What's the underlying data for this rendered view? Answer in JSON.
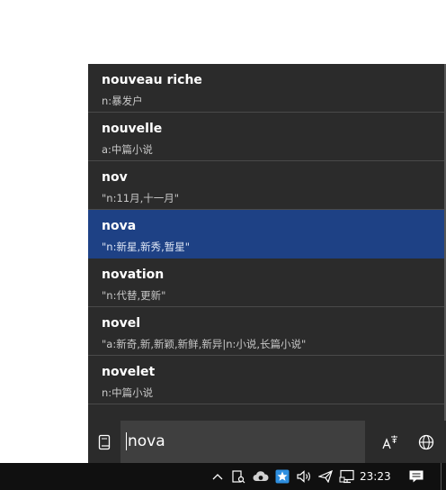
{
  "suggestions": [
    {
      "word": "nouveau riche",
      "definition": "n:暴发户",
      "selected": false
    },
    {
      "word": "nouvelle",
      "definition": "a:中篇小说",
      "selected": false
    },
    {
      "word": "nov",
      "definition": "\"n:11月,十一月\"",
      "selected": false
    },
    {
      "word": "nova",
      "definition": "\"n:新星,新秀,暂星\"",
      "selected": true
    },
    {
      "word": "novation",
      "definition": "\"n:代替,更新\"",
      "selected": false
    },
    {
      "word": "novel",
      "definition": "\"a:新奇,新,新颖,新鲜,新异|n:小说,长篇小说\"",
      "selected": false
    },
    {
      "word": "novelet",
      "definition": "n:中篇小说",
      "selected": false
    }
  ],
  "search": {
    "value": "nova"
  },
  "taskbar": {
    "time": "23:23"
  },
  "colors": {
    "selected": "#1e4185",
    "panel": "#2b2b2b",
    "input": "#3f3f3f",
    "taskbar": "#101010"
  }
}
